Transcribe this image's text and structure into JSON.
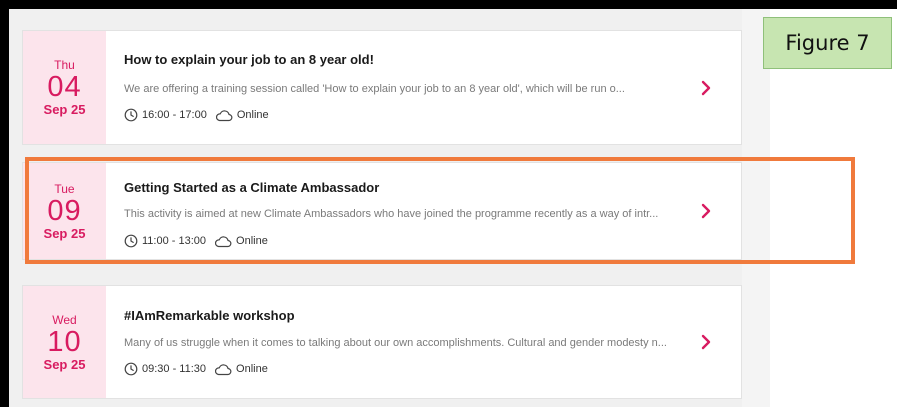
{
  "figure_label": "Figure 7",
  "events": [
    {
      "day_of_week": "Thu",
      "day": "04",
      "month_year": "Sep 25",
      "title": "How to explain your job to an 8 year old!",
      "description": "We are offering a training session called 'How to explain your job to an 8 year old', which will be run o...",
      "time": "16:00 - 17:00",
      "location": "Online"
    },
    {
      "day_of_week": "Tue",
      "day": "09",
      "month_year": "Sep 25",
      "title": "Getting Started as a Climate Ambassador",
      "description": "This activity is aimed at new Climate Ambassadors who have joined the programme recently as a way of intr...",
      "time": "11:00 - 13:00",
      "location": "Online"
    },
    {
      "day_of_week": "Wed",
      "day": "10",
      "month_year": "Sep 25",
      "title": "#IAmRemarkable workshop",
      "description": "Many of us struggle when it comes to talking about our own accomplishments. Cultural and gender modesty n...",
      "time": "09:30 - 11:30",
      "location": "Online"
    }
  ],
  "colors": {
    "accent": "#d81b60",
    "date_background": "#fce4ec",
    "highlight_border": "#f07a3c",
    "figure_label_background": "#c7e5b1"
  },
  "icons": {
    "time": "clock-icon",
    "location": "cloud-icon",
    "open": "chevron-right-icon"
  }
}
